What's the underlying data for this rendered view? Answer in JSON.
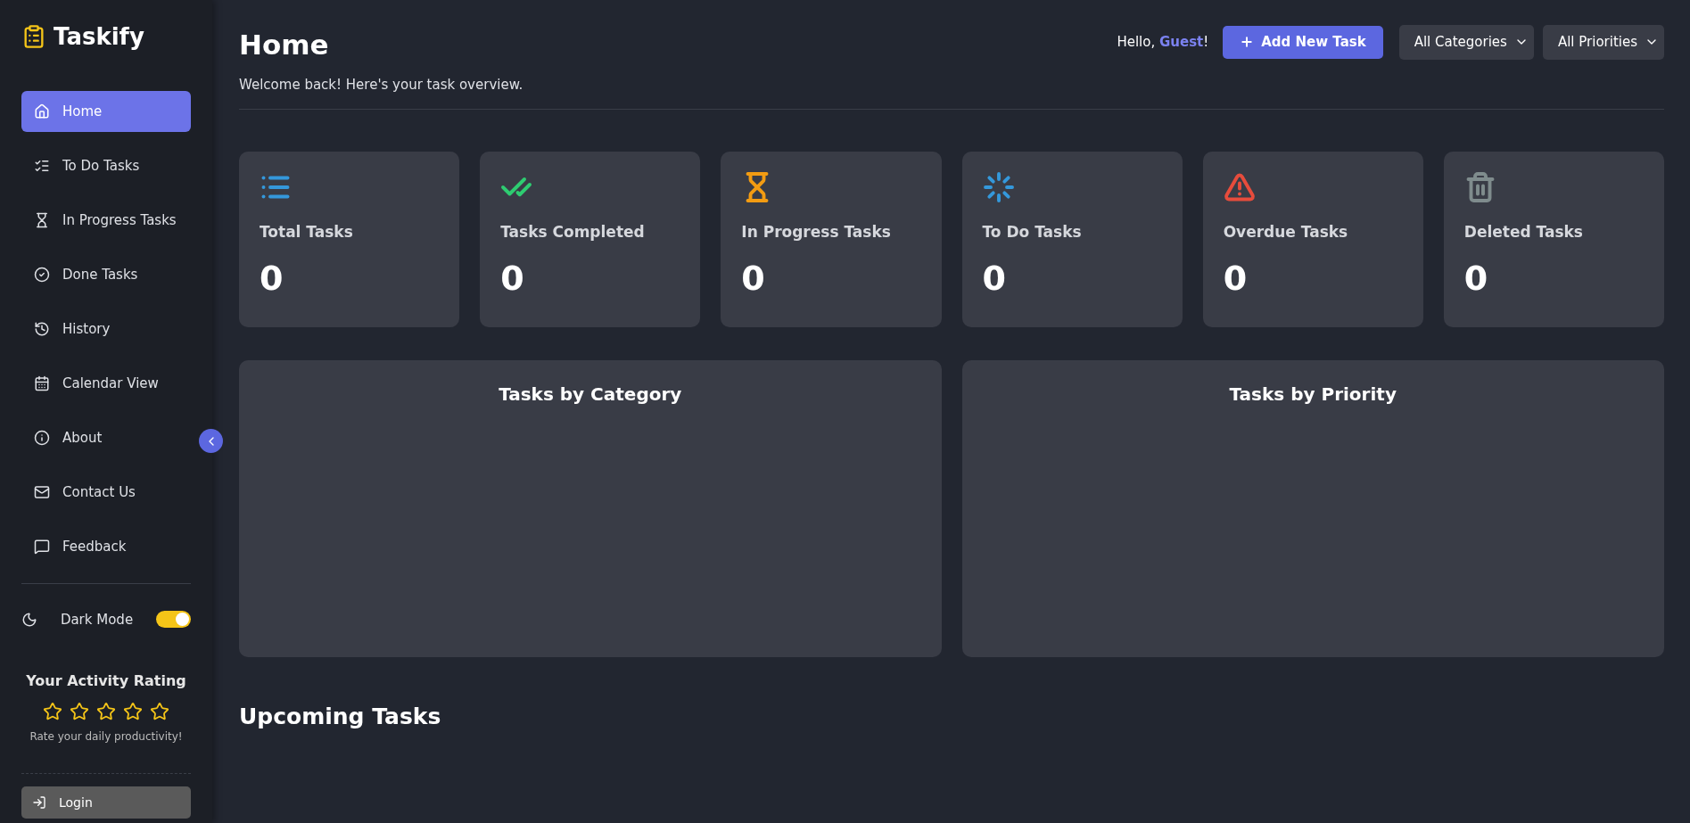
{
  "brand": {
    "name": "Taskify"
  },
  "nav": [
    {
      "label": "Home",
      "kind": "home",
      "selected": true
    },
    {
      "label": "To Do Tasks",
      "kind": "checklist",
      "selected": false
    },
    {
      "label": "In Progress Tasks",
      "kind": "hourglass",
      "selected": false
    },
    {
      "label": "Done Tasks",
      "kind": "check",
      "selected": false
    },
    {
      "label": "History",
      "kind": "history",
      "selected": false
    },
    {
      "label": "Calendar View",
      "kind": "calendar",
      "selected": false
    },
    {
      "label": "About",
      "kind": "info",
      "selected": false
    },
    {
      "label": "Contact Us",
      "kind": "mail",
      "selected": false
    },
    {
      "label": "Feedback",
      "kind": "chat",
      "selected": false
    }
  ],
  "dark_mode": {
    "label": "Dark Mode",
    "on": true
  },
  "rating": {
    "title": "Your Activity Rating",
    "stars": 0,
    "caption": "Rate your daily productivity!"
  },
  "login": {
    "label": "Login"
  },
  "header": {
    "title": "Home",
    "subtitle": "Welcome back! Here's your task overview.",
    "greeting": "Hello,",
    "user": "Guest",
    "greeting_end": "!",
    "add_button": "Add New Task",
    "filters": [
      "All Categories",
      "All Priorities"
    ]
  },
  "stats": [
    {
      "label": "Total Tasks",
      "value": "0",
      "kind": "list",
      "color": "#3498db"
    },
    {
      "label": "Tasks Completed",
      "value": "0",
      "kind": "double-check",
      "color": "#2ecc71"
    },
    {
      "label": "In Progress Tasks",
      "value": "0",
      "kind": "hourglass",
      "color": "#f39c12"
    },
    {
      "label": "To Do Tasks",
      "value": "0",
      "kind": "spinner",
      "color": "#3498db"
    },
    {
      "label": "Overdue Tasks",
      "value": "0",
      "kind": "warning",
      "color": "#e74c3c"
    },
    {
      "label": "Deleted Tasks",
      "value": "0",
      "kind": "trash",
      "color": "#7f8c8d"
    }
  ],
  "panels": [
    {
      "title": "Tasks by Category"
    },
    {
      "title": "Tasks by Priority"
    }
  ],
  "upcoming": {
    "title": "Upcoming Tasks"
  }
}
